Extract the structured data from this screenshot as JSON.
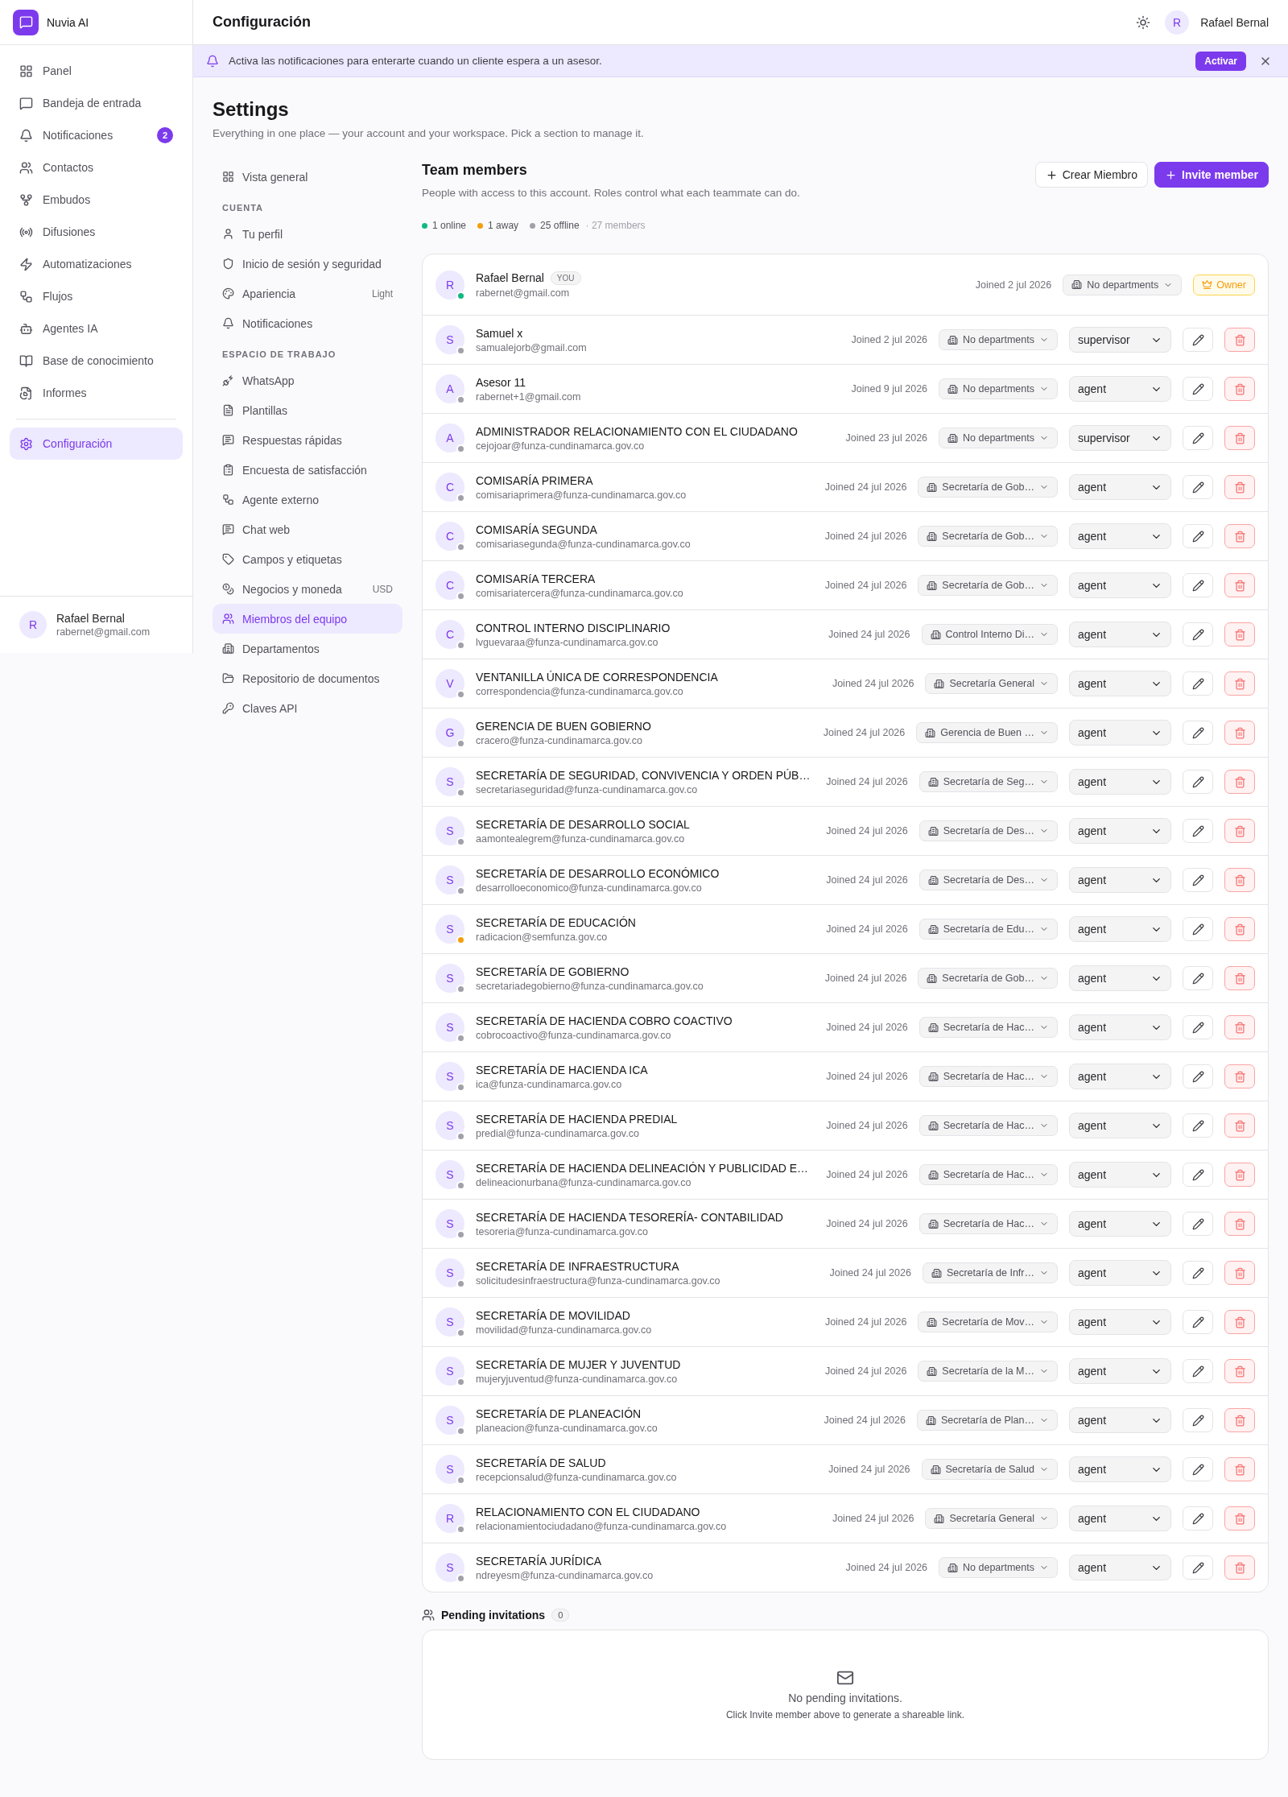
{
  "app": {
    "name": "Nuvia AI"
  },
  "sidebar": {
    "items": [
      {
        "label": "Panel",
        "selected": false
      },
      {
        "label": "Bandeja de entrada",
        "selected": false
      },
      {
        "label": "Notificaciones",
        "selected": false,
        "badge": "2"
      },
      {
        "label": "Contactos",
        "selected": false
      },
      {
        "label": "Embudos",
        "selected": false
      },
      {
        "label": "Difusiones",
        "selected": false
      },
      {
        "label": "Automatizaciones",
        "selected": false
      },
      {
        "label": "Flujos",
        "selected": false
      },
      {
        "label": "Agentes IA",
        "selected": false
      },
      {
        "label": "Base de conocimiento",
        "selected": false
      },
      {
        "label": "Informes",
        "selected": false
      }
    ],
    "bottom_items": [
      {
        "label": "Configuración",
        "selected": true
      }
    ],
    "user": {
      "initial": "R",
      "name": "Rafael Bernal",
      "email": "rabernet@gmail.com"
    }
  },
  "header": {
    "title": "Configuración",
    "user": {
      "initial": "R",
      "name": "Rafael Bernal"
    }
  },
  "banner": {
    "text": "Activa las notificaciones para enterarte cuando un cliente espera a un asesor.",
    "button": "Activar"
  },
  "page": {
    "title": "Settings",
    "subtitle": "Everything in one place — your account and your workspace. Pick a section to manage it."
  },
  "settings_nav": [
    {
      "items": [
        {
          "label": "Vista general",
          "selected": false
        }
      ]
    },
    {
      "heading": "CUENTA",
      "items": [
        {
          "label": "Tu perfil",
          "selected": false
        },
        {
          "label": "Inicio de sesión y seguridad",
          "selected": false
        },
        {
          "label": "Apariencia",
          "selected": false,
          "value": "Light"
        },
        {
          "label": "Notificaciones",
          "selected": false
        }
      ]
    },
    {
      "heading": "ESPACIO DE TRABAJO",
      "items": [
        {
          "label": "WhatsApp",
          "selected": false
        },
        {
          "label": "Plantillas",
          "selected": false
        },
        {
          "label": "Respuestas rápidas",
          "selected": false
        },
        {
          "label": "Encuesta de satisfacción",
          "selected": false
        },
        {
          "label": "Agente externo",
          "selected": false
        },
        {
          "label": "Chat web",
          "selected": false
        },
        {
          "label": "Campos y etiquetas",
          "selected": false
        },
        {
          "label": "Negocios y moneda",
          "selected": false,
          "value": "USD"
        },
        {
          "label": "Miembros del equipo",
          "selected": true
        },
        {
          "label": "Departamentos",
          "selected": false
        },
        {
          "label": "Repositorio de documentos",
          "selected": false
        },
        {
          "label": "Claves API",
          "selected": false
        }
      ]
    }
  ],
  "team": {
    "title": "Team members",
    "description": "People with access to this account. Roles control what each teammate can do.",
    "buttons": [
      {
        "label": "Crear Miembro",
        "kind": "secondary"
      },
      {
        "label": "Invite member",
        "kind": "primary"
      }
    ],
    "stats": [
      {
        "label": "1 online",
        "color": "#10b981"
      },
      {
        "label": "1 away",
        "color": "#f59e0b"
      },
      {
        "label": "25 offline",
        "color": "#a1a1aa"
      }
    ],
    "total": "· 27 members",
    "members": [
      {
        "kind": "owner",
        "initial": "R",
        "name": "Rafael Bernal",
        "you_badge": "YOU",
        "email": "rabernet@gmail.com",
        "joined": "Joined 2 jul 2026",
        "department": "No departments",
        "role": "Owner",
        "color": "#10b981"
      },
      {
        "kind": "member",
        "initial": "S",
        "name": "Samuel x",
        "email": "samualejorb@gmail.com",
        "joined": "Joined 2 jul 2026",
        "department": "No departments",
        "role": "supervisor",
        "color": "#a1a1aa"
      },
      {
        "kind": "member",
        "initial": "A",
        "name": "Asesor 11",
        "email": "rabernet+1@gmail.com",
        "joined": "Joined 9 jul 2026",
        "department": "No departments",
        "role": "agent",
        "color": "#a1a1aa"
      },
      {
        "kind": "member",
        "initial": "A",
        "name": "ADMINISTRADOR RELACIONAMIENTO CON EL CIUDADANO",
        "email": "cejojoar@funza-cundinamarca.gov.co",
        "joined": "Joined 23 jul 2026",
        "department": "No departments",
        "role": "supervisor",
        "color": "#a1a1aa"
      },
      {
        "kind": "member",
        "initial": "C",
        "name": "COMISARÍA PRIMERA",
        "email": "comisariaprimera@funza-cundinamarca.gov.co",
        "joined": "Joined 24 jul 2026",
        "department": "Secretaría de Gob…",
        "role": "agent",
        "color": "#a1a1aa"
      },
      {
        "kind": "member",
        "initial": "C",
        "name": "COMISARÍA SEGUNDA",
        "email": "comisariasegunda@funza-cundinamarca.gov.co",
        "joined": "Joined 24 jul 2026",
        "department": "Secretaría de Gob…",
        "role": "agent",
        "color": "#a1a1aa"
      },
      {
        "kind": "member",
        "initial": "C",
        "name": "COMISARíA TERCERA",
        "email": "comisariatercera@funza-cundinamarca.gov.co",
        "joined": "Joined 24 jul 2026",
        "department": "Secretaría de Gob…",
        "role": "agent",
        "color": "#a1a1aa"
      },
      {
        "kind": "member",
        "initial": "C",
        "name": "CONTROL INTERNO DISCIPLINARIO",
        "email": "lvguevaraa@funza-cundinamarca.gov.co",
        "joined": "Joined 24 jul 2026",
        "department": "Control Interno Di…",
        "role": "agent",
        "color": "#a1a1aa"
      },
      {
        "kind": "member",
        "initial": "V",
        "name": "VENTANILLA ÚNICA DE CORRESPONDENCIA",
        "email": "correspondencia@funza-cundinamarca.gov.co",
        "joined": "Joined 24 jul 2026",
        "department": "Secretaría General",
        "role": "agent",
        "color": "#a1a1aa"
      },
      {
        "kind": "member",
        "initial": "G",
        "name": "GERENCIA DE BUEN GOBIERNO",
        "email": "cracero@funza-cundinamarca.gov.co",
        "joined": "Joined 24 jul 2026",
        "department": "Gerencia de Buen …",
        "role": "agent",
        "color": "#a1a1aa"
      },
      {
        "kind": "member",
        "initial": "S",
        "name": "SECRETARÍA DE SEGURIDAD, CONVIVENCIA Y ORDEN PÚB…",
        "email": "secretariaseguridad@funza-cundinamarca.gov.co",
        "joined": "Joined 24 jul 2026",
        "department": "Secretaría de Seg…",
        "role": "agent",
        "color": "#a1a1aa"
      },
      {
        "kind": "member",
        "initial": "S",
        "name": "SECRETARÍA DE DESARROLLO SOCIAL",
        "email": "aamontealegrem@funza-cundinamarca.gov.co",
        "joined": "Joined 24 jul 2026",
        "department": "Secretaría de Des…",
        "role": "agent",
        "color": "#a1a1aa"
      },
      {
        "kind": "member",
        "initial": "S",
        "name": "SECRETARÍA DE DESARROLLO ECONÓMICO",
        "email": "desarrolloeconomico@funza-cundinamarca.gov.co",
        "joined": "Joined 24 jul 2026",
        "department": "Secretaría de Des…",
        "role": "agent",
        "color": "#a1a1aa"
      },
      {
        "kind": "member",
        "initial": "S",
        "name": "SECRETARÍA DE EDUCACIÓN",
        "email": "radicacion@semfunza.gov.co",
        "joined": "Joined 24 jul 2026",
        "department": "Secretaría de Edu…",
        "role": "agent",
        "color": "#f59e0b"
      },
      {
        "kind": "member",
        "initial": "S",
        "name": "SECRETARÍA DE GOBIERNO",
        "email": "secretariadegobierno@funza-cundinamarca.gov.co",
        "joined": "Joined 24 jul 2026",
        "department": "Secretaría de Gob…",
        "role": "agent",
        "color": "#a1a1aa"
      },
      {
        "kind": "member",
        "initial": "S",
        "name": "SECRETARÍA DE HACIENDA COBRO COACTIVO",
        "email": "cobrocoactivo@funza-cundinamarca.gov.co",
        "joined": "Joined 24 jul 2026",
        "department": "Secretaría de Hac…",
        "role": "agent",
        "color": "#a1a1aa"
      },
      {
        "kind": "member",
        "initial": "S",
        "name": "SECRETARÍA DE HACIENDA ICA",
        "email": "ica@funza-cundinamarca.gov.co",
        "joined": "Joined 24 jul 2026",
        "department": "Secretaría de Hac…",
        "role": "agent",
        "color": "#a1a1aa"
      },
      {
        "kind": "member",
        "initial": "S",
        "name": "SECRETARÍA DE HACIENDA PREDIAL",
        "email": "predial@funza-cundinamarca.gov.co",
        "joined": "Joined 24 jul 2026",
        "department": "Secretaría de Hac…",
        "role": "agent",
        "color": "#a1a1aa"
      },
      {
        "kind": "member",
        "initial": "S",
        "name": "SECRETARÍA DE HACIENDA DELINEACIÓN Y PUBLICIDAD E…",
        "email": "delineacionurbana@funza-cundinamarca.gov.co",
        "joined": "Joined 24 jul 2026",
        "department": "Secretaría de Hac…",
        "role": "agent",
        "color": "#a1a1aa"
      },
      {
        "kind": "member",
        "initial": "S",
        "name": "SECRETARÍA DE HACIENDA TESORERÍA- CONTABILIDAD",
        "email": "tesoreria@funza-cundinamarca.gov.co",
        "joined": "Joined 24 jul 2026",
        "department": "Secretaría de Hac…",
        "role": "agent",
        "color": "#a1a1aa"
      },
      {
        "kind": "member",
        "initial": "S",
        "name": "SECRETARÍA DE INFRAESTRUCTURA",
        "email": "solicitudesinfraestructura@funza-cundinamarca.gov.co",
        "joined": "Joined 24 jul 2026",
        "department": "Secretaría de Infr…",
        "role": "agent",
        "color": "#a1a1aa"
      },
      {
        "kind": "member",
        "initial": "S",
        "name": "SECRETARÍA DE MOVILIDAD",
        "email": "movilidad@funza-cundinamarca.gov.co",
        "joined": "Joined 24 jul 2026",
        "department": "Secretaría de Mov…",
        "role": "agent",
        "color": "#a1a1aa"
      },
      {
        "kind": "member",
        "initial": "S",
        "name": "SECRETARÍA DE MUJER Y JUVENTUD",
        "email": "mujeryjuventud@funza-cundinamarca.gov.co",
        "joined": "Joined 24 jul 2026",
        "department": "Secretaría de la M…",
        "role": "agent",
        "color": "#a1a1aa"
      },
      {
        "kind": "member",
        "initial": "S",
        "name": "SECRETARÍA DE PLANEACIÓN",
        "email": "planeacion@funza-cundinamarca.gov.co",
        "joined": "Joined 24 jul 2026",
        "department": "Secretaría de Plan…",
        "role": "agent",
        "color": "#a1a1aa"
      },
      {
        "kind": "member",
        "initial": "S",
        "name": "SECRETARÍA DE SALUD",
        "email": "recepcionsalud@funza-cundinamarca.gov.co",
        "joined": "Joined 24 jul 2026",
        "department": "Secretaría de Salud",
        "role": "agent",
        "color": "#a1a1aa"
      },
      {
        "kind": "member",
        "initial": "R",
        "name": "RELACIONAMIENTO CON EL CIUDADANO",
        "email": "relacionamientociudadano@funza-cundinamarca.gov.co",
        "joined": "Joined 24 jul 2026",
        "department": "Secretaría General",
        "role": "agent",
        "color": "#a1a1aa"
      },
      {
        "kind": "member",
        "initial": "S",
        "name": "SECRETARÍA JURÍDICA",
        "email": "ndreyesm@funza-cundinamarca.gov.co",
        "joined": "Joined 24 jul 2026",
        "department": "No departments",
        "role": "agent",
        "color": "#a1a1aa"
      }
    ]
  },
  "pending": {
    "title": "Pending invitations",
    "count": "0",
    "empty_title": "No pending invitations.",
    "empty_hint": "Click Invite member above to generate a shareable link."
  }
}
